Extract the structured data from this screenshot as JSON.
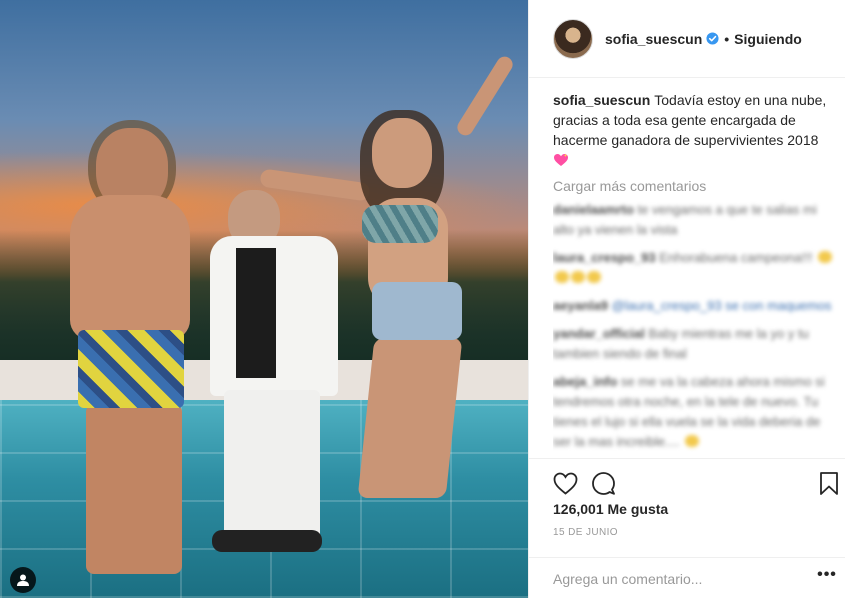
{
  "post": {
    "author": "sofia_suescun",
    "verified": true,
    "follow_separator": "•",
    "follow_status": "Siguiendo"
  },
  "caption": {
    "user": "sofia_suescun",
    "text": "Todavía estoy en una nube, gracias a toda esa gente encargada de hacerme ganadora de supervivientes 2018"
  },
  "comments": {
    "load_more": "Cargar más comentarios",
    "blurred_rows": [
      {
        "user": "danielaamrto",
        "text": "te vengamos a que te salias mi alto ya vienen la vista"
      },
      {
        "user": "laura_crespo_93",
        "text": "Enhorabuena campeona!!!"
      },
      {
        "user": "aeyanla9",
        "text": "@laura_crespo_93 se con maquemos"
      },
      {
        "user": "yandar_official",
        "text": "Baby mientras me la yo y tu tambien siendo de final"
      },
      {
        "user": "abeja_info",
        "text": "se me va la cabeza ahora mismo si tendremos otra noche, en la tele de nuevo. Tu tienes el lujo si ella vuela se la vida deberia de ser la mas increible...."
      }
    ]
  },
  "actions": {
    "like_icon": "heart-icon",
    "comment_icon": "comment-icon",
    "save_icon": "bookmark-icon",
    "likes": "126,001 Me gusta",
    "date": "15 DE JUNIO"
  },
  "composer": {
    "placeholder": "Agrega un comentario...",
    "more_label": "•••"
  },
  "colors": {
    "text": "#262626",
    "muted": "#999999",
    "verified": "#3897f0",
    "border": "#efefef"
  }
}
